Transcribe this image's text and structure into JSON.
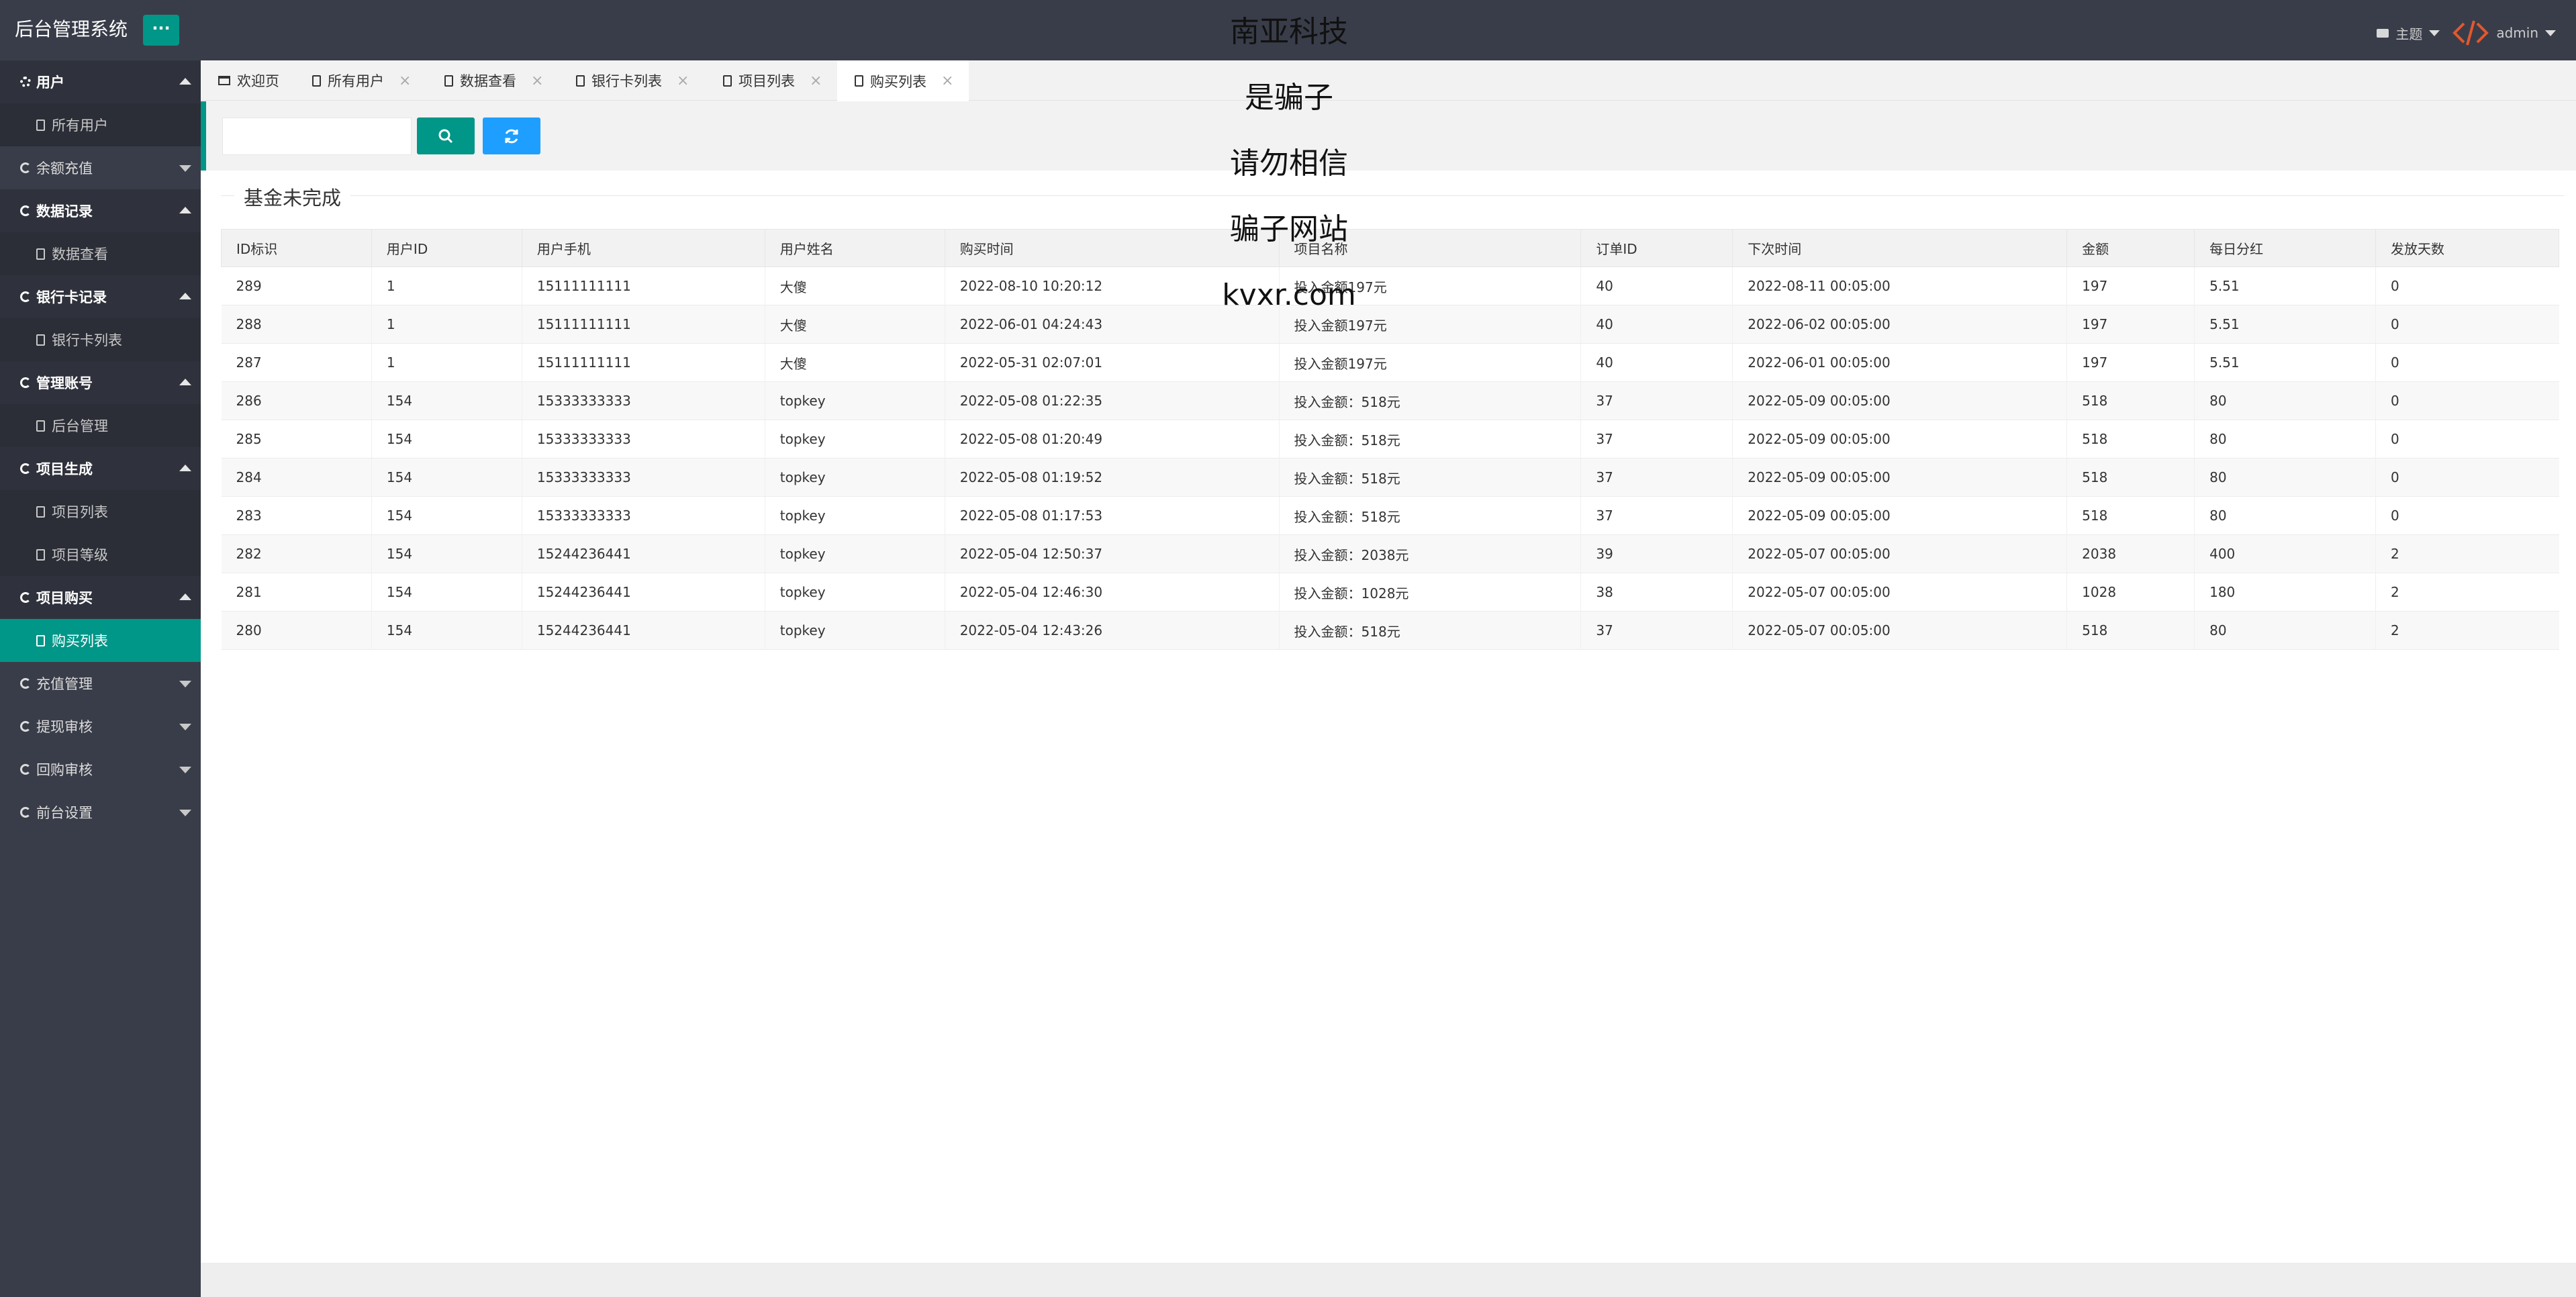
{
  "header": {
    "logo": "后台管理系统",
    "menu_toggle": "···",
    "theme_label": "主题",
    "user_label": "admin"
  },
  "sidebar": {
    "groups": [
      {
        "label": "用户",
        "icon": "gear-icon",
        "open": true,
        "children": [
          "所有用户"
        ]
      },
      {
        "label": "余额充值",
        "icon": "circle-icon",
        "open": false,
        "children": []
      },
      {
        "label": "数据记录",
        "icon": "circle-icon",
        "open": true,
        "children": [
          "数据查看"
        ]
      },
      {
        "label": "银行卡记录",
        "icon": "circle-icon",
        "open": true,
        "children": [
          "银行卡列表"
        ]
      },
      {
        "label": "管理账号",
        "icon": "circle-icon",
        "open": true,
        "children": [
          "后台管理"
        ]
      },
      {
        "label": "项目生成",
        "icon": "circle-icon",
        "open": true,
        "children": [
          "项目列表",
          "项目等级"
        ]
      },
      {
        "label": "项目购买",
        "icon": "circle-icon",
        "open": true,
        "children": [
          "购买列表"
        ]
      },
      {
        "label": "充值管理",
        "icon": "circle-icon",
        "open": false,
        "children": []
      },
      {
        "label": "提现审核",
        "icon": "circle-icon",
        "open": false,
        "children": []
      },
      {
        "label": "回购审核",
        "icon": "circle-icon",
        "open": false,
        "children": []
      },
      {
        "label": "前台设置",
        "icon": "circle-icon",
        "open": false,
        "children": []
      }
    ],
    "active_item": "购买列表"
  },
  "tabs": [
    {
      "label": "欢迎页",
      "closable": false,
      "active": false
    },
    {
      "label": "所有用户",
      "closable": true,
      "active": false
    },
    {
      "label": "数据查看",
      "closable": true,
      "active": false
    },
    {
      "label": "银行卡列表",
      "closable": true,
      "active": false
    },
    {
      "label": "项目列表",
      "closable": true,
      "active": false
    },
    {
      "label": "购买列表",
      "closable": true,
      "active": true
    }
  ],
  "toolbar": {
    "search_value": "",
    "search_placeholder": ""
  },
  "section": {
    "legend": "基金未完成"
  },
  "table": {
    "columns": [
      "ID标识",
      "用户ID",
      "用户手机",
      "用户姓名",
      "购买时间",
      "项目名称",
      "订单ID",
      "下次时间",
      "金额",
      "每日分红",
      "发放天数"
    ],
    "rows": [
      [
        "289",
        "1",
        "15111111111",
        "大傻",
        "2022-08-10 10:20:12",
        "投入金额197元",
        "40",
        "2022-08-11 00:05:00",
        "197",
        "5.51",
        "0"
      ],
      [
        "288",
        "1",
        "15111111111",
        "大傻",
        "2022-06-01 04:24:43",
        "投入金额197元",
        "40",
        "2022-06-02 00:05:00",
        "197",
        "5.51",
        "0"
      ],
      [
        "287",
        "1",
        "15111111111",
        "大傻",
        "2022-05-31 02:07:01",
        "投入金额197元",
        "40",
        "2022-06-01 00:05:00",
        "197",
        "5.51",
        "0"
      ],
      [
        "286",
        "154",
        "15333333333",
        "topkey",
        "2022-05-08 01:22:35",
        "投入金额：518元",
        "37",
        "2022-05-09 00:05:00",
        "518",
        "80",
        "0"
      ],
      [
        "285",
        "154",
        "15333333333",
        "topkey",
        "2022-05-08 01:20:49",
        "投入金额：518元",
        "37",
        "2022-05-09 00:05:00",
        "518",
        "80",
        "0"
      ],
      [
        "284",
        "154",
        "15333333333",
        "topkey",
        "2022-05-08 01:19:52",
        "投入金额：518元",
        "37",
        "2022-05-09 00:05:00",
        "518",
        "80",
        "0"
      ],
      [
        "283",
        "154",
        "15333333333",
        "topkey",
        "2022-05-08 01:17:53",
        "投入金额：518元",
        "37",
        "2022-05-09 00:05:00",
        "518",
        "80",
        "0"
      ],
      [
        "282",
        "154",
        "15244236441",
        "topkey",
        "2022-05-04 12:50:37",
        "投入金额：2038元",
        "39",
        "2022-05-07 00:05:00",
        "2038",
        "400",
        "2"
      ],
      [
        "281",
        "154",
        "15244236441",
        "topkey",
        "2022-05-04 12:46:30",
        "投入金额：1028元",
        "38",
        "2022-05-07 00:05:00",
        "1028",
        "180",
        "2"
      ],
      [
        "280",
        "154",
        "15244236441",
        "topkey",
        "2022-05-04 12:43:26",
        "投入金额：518元",
        "37",
        "2022-05-07 00:05:00",
        "518",
        "80",
        "2"
      ]
    ]
  },
  "overlay": {
    "lines": [
      "南亚科技",
      "是骗子",
      "请勿相信",
      "骗子网站",
      "kvxr.com"
    ]
  },
  "colors": {
    "header_bg": "#393d49",
    "accent": "#009688",
    "refresh_button": "#1e9fff"
  }
}
